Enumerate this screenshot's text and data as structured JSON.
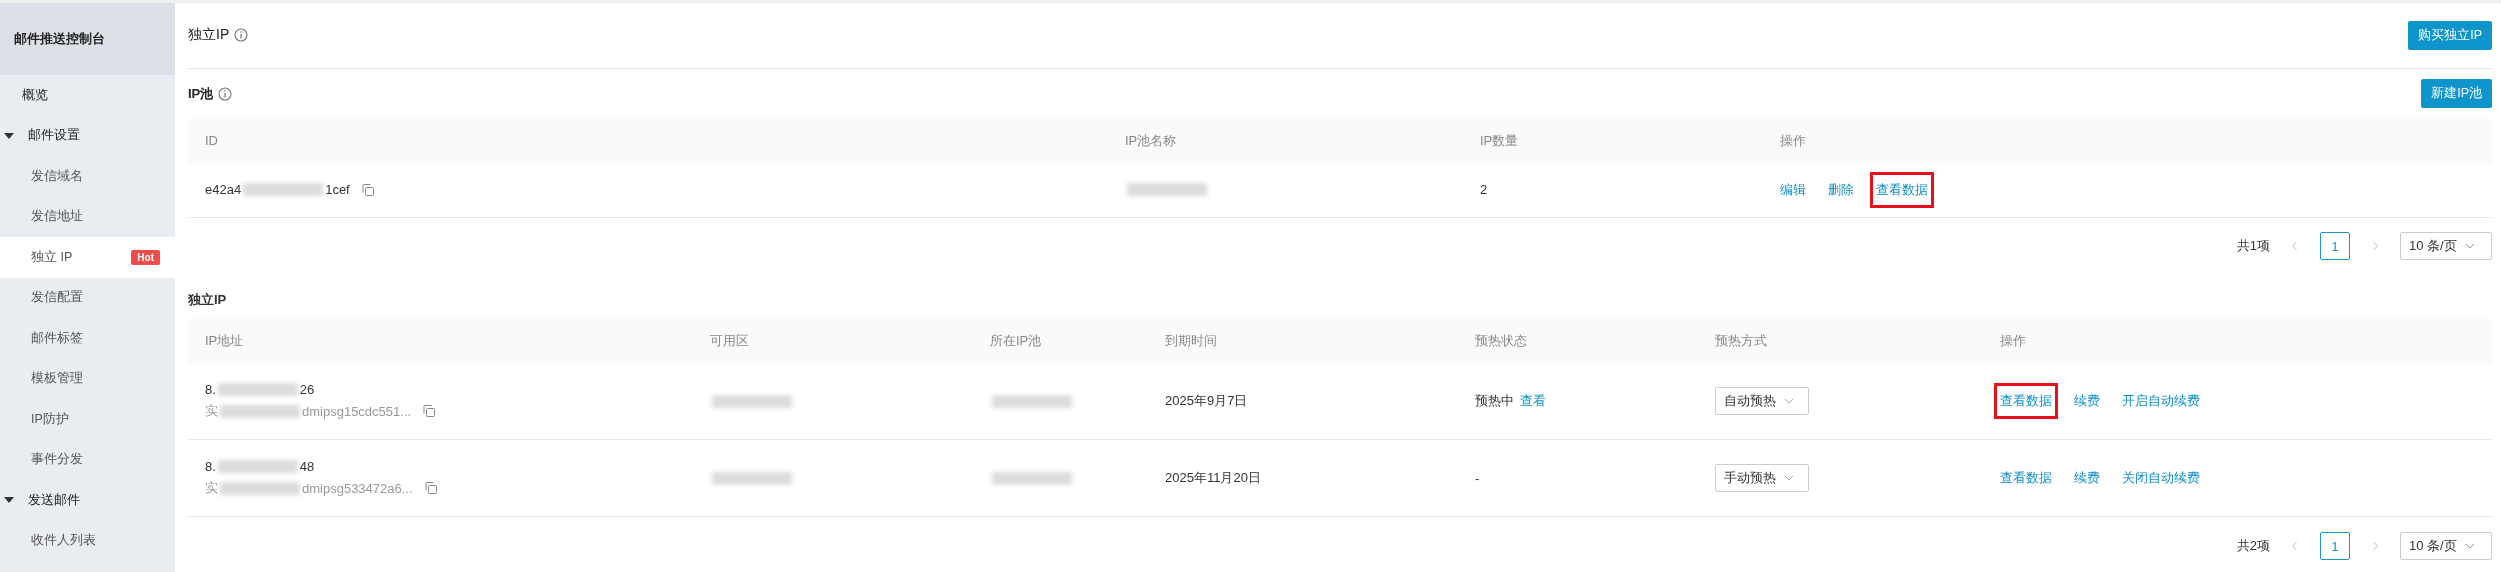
{
  "sidebar": {
    "title": "邮件推送控制台",
    "items": [
      {
        "label": "概览",
        "kind": "link",
        "selected": false
      },
      {
        "label": "邮件设置",
        "kind": "group",
        "expanded": true,
        "children": [
          {
            "label": "发信域名",
            "kind": "link",
            "selected": false
          },
          {
            "label": "发信地址",
            "kind": "link",
            "selected": false
          },
          {
            "label": "独立 IP",
            "kind": "link",
            "selected": true,
            "badge": "Hot"
          },
          {
            "label": "发信配置",
            "kind": "link",
            "selected": false
          },
          {
            "label": "邮件标签",
            "kind": "link",
            "selected": false
          },
          {
            "label": "模板管理",
            "kind": "link",
            "selected": false
          },
          {
            "label": "IP防护",
            "kind": "link",
            "selected": false
          },
          {
            "label": "事件分发",
            "kind": "link",
            "selected": false
          }
        ]
      },
      {
        "label": "发送邮件",
        "kind": "group",
        "expanded": true,
        "children": [
          {
            "label": "收件人列表",
            "kind": "link",
            "selected": false
          }
        ]
      }
    ]
  },
  "page": {
    "title": "独立IP",
    "button": "购买独立IP"
  },
  "ip_pool": {
    "title": "IP池",
    "button": "新建IP池",
    "columns": [
      "ID",
      "IP池名称",
      "IP数量",
      "操作"
    ],
    "rows": [
      {
        "id": {
          "before": "e42a4",
          "after": "1cef",
          "redacted": true
        },
        "name": {
          "redacted": true
        },
        "count": "2",
        "actions": [
          {
            "label": "编辑",
            "highlighted": false
          },
          {
            "label": "删除",
            "highlighted": false
          },
          {
            "label": "查看数据",
            "highlighted": true
          }
        ]
      }
    ],
    "pagination": {
      "total": "共1项",
      "page": "1",
      "page_size": "10 条/页"
    }
  },
  "ips": {
    "title": "独立IP",
    "columns": [
      "IP地址",
      "可用区",
      "所在IP池",
      "到期时间",
      "预热状态",
      "预热方式",
      "操作"
    ],
    "rows": [
      {
        "ip": {
          "before": "8.",
          "after": "26",
          "redacted": true
        },
        "instance": {
          "before": "实",
          "after": "dmipsg15cdc551...",
          "redacted": true
        },
        "zone": {
          "redacted": true
        },
        "pool": {
          "redacted": true
        },
        "expires": "2025年9月7日",
        "status": "预热中",
        "status_link": "查看",
        "mode": "自动预热",
        "actions": [
          {
            "label": "查看数据",
            "highlighted": true
          },
          {
            "label": "续费",
            "highlighted": false
          },
          {
            "label": "开启自动续费",
            "highlighted": false
          }
        ]
      },
      {
        "ip": {
          "before": "8.",
          "after": "48",
          "redacted": true
        },
        "instance": {
          "before": "实",
          "after": "dmipsg533472a6...",
          "redacted": true
        },
        "zone": {
          "redacted": true
        },
        "pool": {
          "redacted": true
        },
        "expires": "2025年11月20日",
        "status": "-",
        "mode": "手动预热",
        "actions": [
          {
            "label": "查看数据",
            "highlighted": false
          },
          {
            "label": "续费",
            "highlighted": false
          },
          {
            "label": "关闭自动续费",
            "highlighted": false
          }
        ]
      }
    ],
    "pagination": {
      "total": "共2项",
      "page": "1",
      "page_size": "10 条/页"
    }
  }
}
